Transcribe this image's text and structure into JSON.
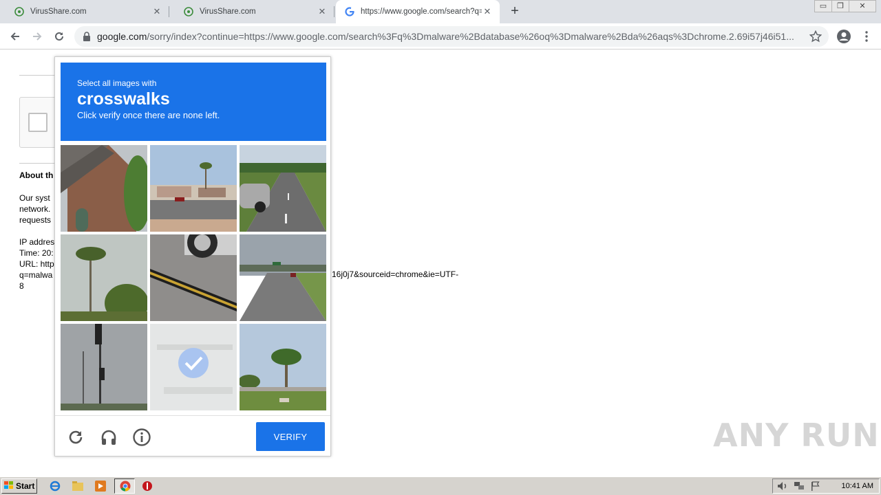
{
  "browser": {
    "tabs": [
      {
        "title": "VirusShare.com",
        "favicon": "virusshare-biohazard-icon"
      },
      {
        "title": "VirusShare.com",
        "favicon": "virusshare-biohazard-icon"
      },
      {
        "title": "https://www.google.com/search?q=",
        "favicon": "google-g-icon"
      }
    ],
    "address_host": "google.com",
    "address_path": "/sorry/index?continue=https://www.google.com/search%3Fq%3Dmalware%2Bdatabase%26oq%3Dmalware%2Bda%26aqs%3Dchrome.2.69i57j46i51..."
  },
  "page": {
    "about_heading": "About th",
    "body_lines": [
      "Our syst",
      "network.",
      "requests"
    ],
    "info_lines": [
      "IP addres",
      "Time: 20:",
      "URL: http",
      "q=malwa",
      "8"
    ],
    "url_tail": "16j0j7&sourceid=chrome&ie=UTF-"
  },
  "captcha": {
    "prompt_pre": "Select all images with",
    "target": "crosswalks",
    "prompt_post": "Click verify once there are none left.",
    "verify_label": "VERIFY",
    "selected_tiles": [
      8
    ],
    "accent": "#1a73e8"
  },
  "watermark": "ANY RUN",
  "taskbar": {
    "start_label": "Start",
    "clock": "10:41 AM"
  }
}
